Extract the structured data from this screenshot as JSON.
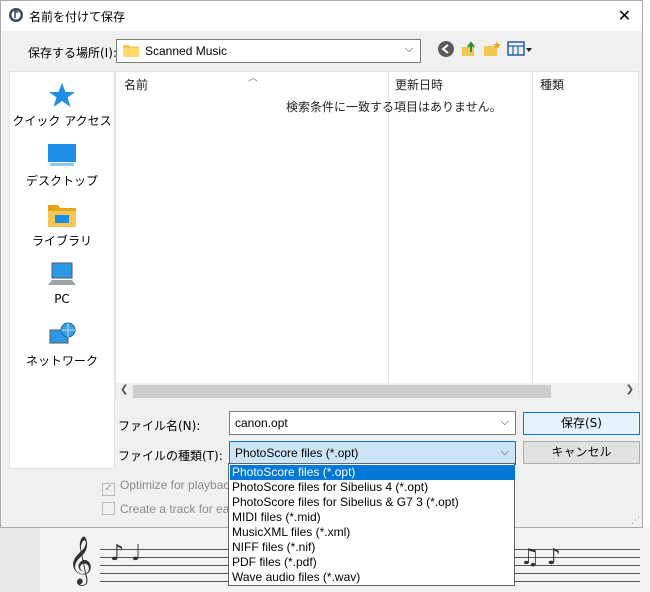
{
  "window": {
    "title": "名前を付けて保存",
    "close_glyph": "✕"
  },
  "location": {
    "label": "保存する場所(I):",
    "value": "Scanned Music"
  },
  "places": [
    {
      "label": "クイック アクセス",
      "icon": "star-icon"
    },
    {
      "label": "デスクトップ",
      "icon": "desktop-icon"
    },
    {
      "label": "ライブラリ",
      "icon": "library-icon"
    },
    {
      "label": "PC",
      "icon": "pc-icon"
    },
    {
      "label": "ネットワーク",
      "icon": "network-icon"
    }
  ],
  "file_list": {
    "columns": [
      "名前",
      "更新日時",
      "種類"
    ],
    "empty_message": "検索条件に一致する項目はありません。"
  },
  "filename": {
    "label": "ファイル名(N):",
    "value": "canon.opt"
  },
  "filetype": {
    "label": "ファイルの種類(T):",
    "value": "PhotoScore files (*.opt)",
    "options": [
      "PhotoScore files (*.opt)",
      "PhotoScore files for Sibelius 4 (*.opt)",
      "PhotoScore files for Sibelius & G7 3 (*.opt)",
      "MIDI files (*.mid)",
      "MusicXML files (*.xml)",
      "NIFF files (*.nif)",
      "PDF files (*.pdf)",
      "Wave audio files (*.wav)"
    ],
    "selected_index": 0
  },
  "buttons": {
    "save": "保存(S)",
    "cancel": "キャンセル"
  },
  "options": {
    "optimize_playback": "Optimize for playback",
    "create_track": "Create a track for each"
  },
  "colors": {
    "accent": "#0078d7",
    "dialog_bg": "#f0f0f0"
  }
}
